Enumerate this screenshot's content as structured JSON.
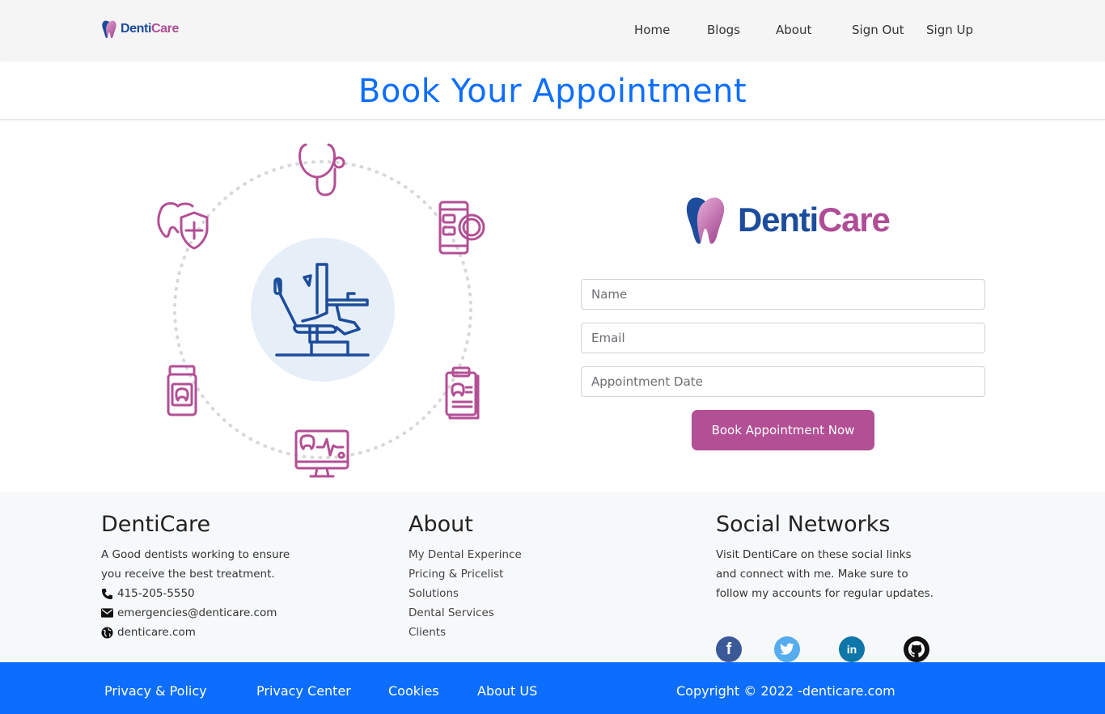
{
  "brand": {
    "name_part1": "Denti",
    "name_part2": "Care"
  },
  "nav": {
    "home": "Home",
    "blogs": "Blogs",
    "about": "About",
    "sign_out": "Sign Out",
    "sign_up": "Sign Up"
  },
  "page_title": "Book Your Appointment",
  "form": {
    "name_placeholder": "Name",
    "email_placeholder": "Email",
    "date_placeholder": "Appointment Date",
    "submit_label": "Book Appointment Now"
  },
  "footer": {
    "col1": {
      "heading": "DentiCare",
      "desc_line1": "A Good dentists working to ensure",
      "desc_line2": "you receive the best treatment.",
      "phone": "415-205-5550",
      "email": "emergencies@denticare.com",
      "website": "denticare.com"
    },
    "col2": {
      "heading": "About",
      "links": [
        "My Dental Experince",
        "Pricing & Pricelist",
        "Solutions",
        "Dental Services",
        "Clients"
      ]
    },
    "col3": {
      "heading": "Social Networks",
      "line1": "Visit DentiCare on these social links",
      "line2": "and connect with me. Make sure to",
      "line3": "follow my accounts for regular updates.",
      "icons": [
        "facebook-icon",
        "twitter-icon",
        "linkedin-icon",
        "github-icon"
      ]
    }
  },
  "bottom_bar": {
    "links": [
      "Privacy & Policy",
      "Privacy Center",
      "Cookies",
      "About US"
    ],
    "copyright": "Copyright © 2022 -denticare.com"
  },
  "colors": {
    "primary_blue": "#0d6efd",
    "accent_magenta": "#b34f95",
    "brand_navy": "#1c4c9c"
  }
}
